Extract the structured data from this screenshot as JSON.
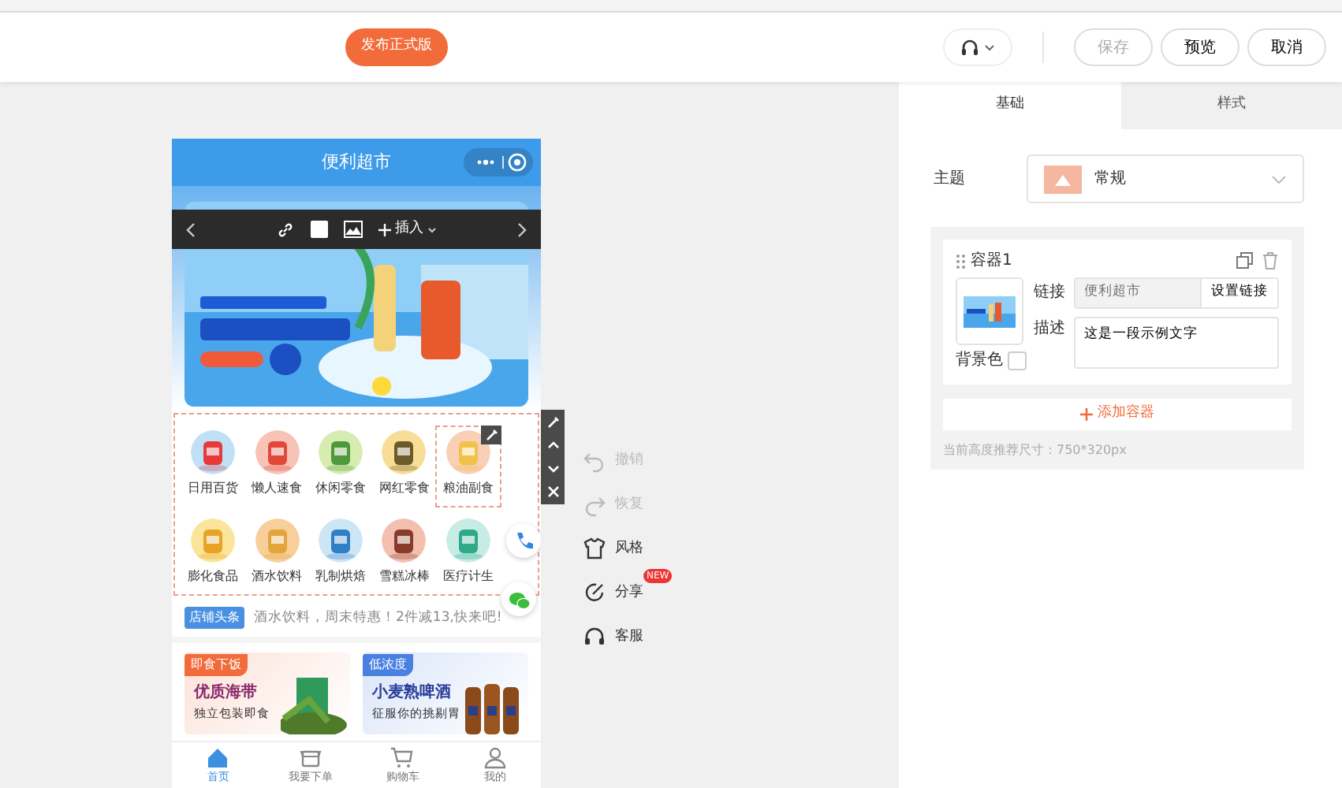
{
  "header": {
    "publish_button": "发布正式版",
    "actions": [
      {
        "label": "保存",
        "disabled": true
      },
      {
        "label": "预览",
        "disabled": false
      },
      {
        "label": "取消",
        "disabled": false
      }
    ]
  },
  "phone": {
    "title": "便利超市",
    "editor_toolbar": {
      "insert_label": "插入"
    },
    "categories": [
      {
        "label": "日用百货",
        "selected": false
      },
      {
        "label": "懒人速食",
        "selected": false
      },
      {
        "label": "休闲零食",
        "selected": false
      },
      {
        "label": "网红零食",
        "selected": false
      },
      {
        "label": "粮油副食",
        "selected": true
      },
      {
        "label": "膨化食品",
        "selected": false
      },
      {
        "label": "酒水饮料",
        "selected": false
      },
      {
        "label": "乳制烘焙",
        "selected": false
      },
      {
        "label": "雪糕冰棒",
        "selected": false
      },
      {
        "label": "医疗计生",
        "selected": false
      }
    ],
    "notice": {
      "badge": "店铺头条",
      "text": "酒水饮料，周末特惠！2件减13,快来吧!"
    },
    "promos": [
      {
        "tag": "即食下饭",
        "title": "优质海带",
        "subtitle": "独立包装即食",
        "color": "#f26b3a"
      },
      {
        "tag": "低浓度",
        "title": "小麦熟啤酒",
        "subtitle": "征服你的挑剔胃",
        "color": "#4a80e0"
      }
    ],
    "tabbar": [
      {
        "label": "首页",
        "selected": true
      },
      {
        "label": "我要下单",
        "selected": false
      },
      {
        "label": "购物车",
        "selected": false
      },
      {
        "label": "我的",
        "selected": false
      }
    ]
  },
  "side_actions": [
    {
      "label": "撤销",
      "disabled": true
    },
    {
      "label": "恢复",
      "disabled": true
    },
    {
      "label": "风格",
      "disabled": false
    },
    {
      "label": "分享",
      "disabled": false,
      "badge": "NEW"
    },
    {
      "label": "客服",
      "disabled": false
    }
  ],
  "panel": {
    "tabs": [
      {
        "label": "基础",
        "selected": true
      },
      {
        "label": "样式",
        "selected": false
      }
    ],
    "theme": {
      "label": "主题",
      "value": "常规"
    },
    "container": {
      "title": "容器1",
      "link_label": "链接",
      "link_placeholder": "便利超市",
      "link_button": "设置链接",
      "desc_label": "描述",
      "desc_value": "这是一段示例文字",
      "bg_label": "背景色"
    },
    "add_button": "添加容器",
    "hint": "当前高度推荐尺寸：750*320px"
  }
}
